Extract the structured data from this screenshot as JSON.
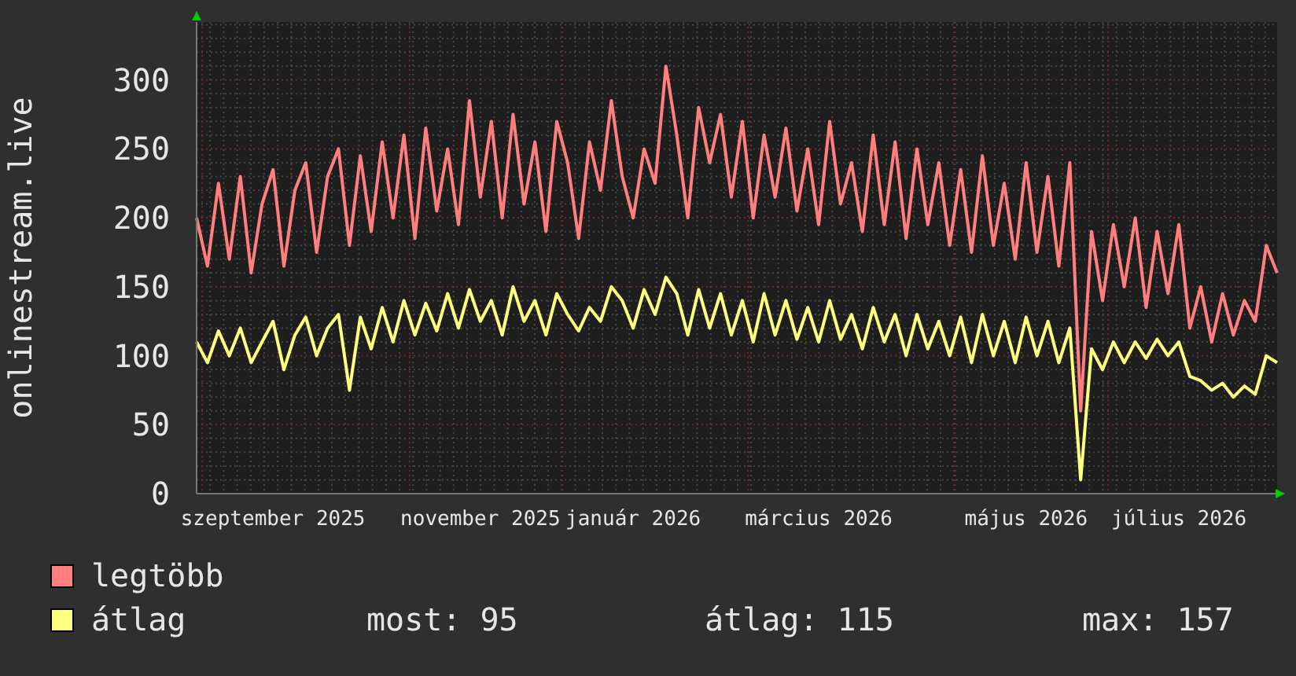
{
  "chart": {
    "chart_data": {
      "type": "line",
      "ylabel": "onlinestream.live",
      "categories": [
        null,
        null,
        null,
        null,
        null,
        null,
        null,
        "szeptember 2025",
        null,
        null,
        null,
        null,
        null,
        null,
        null,
        null,
        null,
        null,
        null,
        null,
        null,
        null,
        null,
        null,
        null,
        null,
        "november 2025",
        null,
        null,
        null,
        null,
        null,
        null,
        null,
        null,
        null,
        null,
        null,
        null,
        null,
        "január 2026",
        null,
        null,
        null,
        null,
        null,
        null,
        null,
        null,
        null,
        null,
        null,
        null,
        null,
        null,
        null,
        null,
        "március 2026",
        null,
        null,
        null,
        null,
        null,
        null,
        null,
        null,
        null,
        null,
        null,
        null,
        null,
        null,
        null,
        null,
        null,
        null,
        "május 2026",
        null,
        null,
        null,
        null,
        null,
        null,
        null,
        null,
        null,
        null,
        null,
        null,
        null,
        "július 2026",
        null,
        null,
        null,
        null,
        null,
        null,
        null,
        null,
        null
      ],
      "series": [
        {
          "name": "legtöbb",
          "color": "#ff7f7f",
          "values": [
            200,
            165,
            225,
            170,
            230,
            160,
            210,
            235,
            165,
            220,
            240,
            175,
            230,
            250,
            180,
            245,
            190,
            255,
            200,
            260,
            185,
            265,
            205,
            250,
            195,
            285,
            215,
            270,
            200,
            275,
            210,
            255,
            190,
            270,
            240,
            185,
            255,
            220,
            285,
            230,
            200,
            250,
            225,
            310,
            260,
            200,
            280,
            240,
            275,
            215,
            270,
            200,
            260,
            215,
            265,
            205,
            250,
            195,
            270,
            210,
            240,
            190,
            260,
            195,
            255,
            185,
            250,
            195,
            240,
            180,
            235,
            175,
            245,
            180,
            225,
            170,
            240,
            175,
            230,
            165,
            240,
            60,
            190,
            140,
            195,
            150,
            200,
            135,
            190,
            145,
            195,
            120,
            150,
            110,
            145,
            115,
            140,
            125,
            180,
            160
          ]
        },
        {
          "name": "átlag",
          "color": "#ffff7f",
          "values": [
            110,
            95,
            118,
            100,
            120,
            95,
            110,
            125,
            90,
            115,
            128,
            100,
            120,
            130,
            75,
            128,
            105,
            135,
            110,
            140,
            115,
            138,
            118,
            145,
            120,
            148,
            125,
            140,
            115,
            150,
            125,
            140,
            115,
            145,
            130,
            118,
            135,
            125,
            150,
            140,
            120,
            148,
            130,
            157,
            145,
            115,
            148,
            120,
            145,
            115,
            140,
            110,
            145,
            115,
            140,
            112,
            135,
            110,
            140,
            112,
            130,
            105,
            135,
            110,
            130,
            100,
            130,
            105,
            125,
            100,
            128,
            95,
            130,
            100,
            125,
            95,
            128,
            100,
            125,
            95,
            120,
            10,
            105,
            90,
            110,
            95,
            110,
            98,
            112,
            100,
            110,
            85,
            82,
            75,
            80,
            70,
            78,
            72,
            100,
            95
          ]
        }
      ],
      "ylim": [
        0,
        342
      ],
      "grid": true,
      "yticks": [
        0,
        50,
        100,
        150,
        200,
        250,
        300
      ]
    }
  },
  "legend_stats": [
    "most: 95",
    "átlag: 115",
    "max: 157"
  ]
}
